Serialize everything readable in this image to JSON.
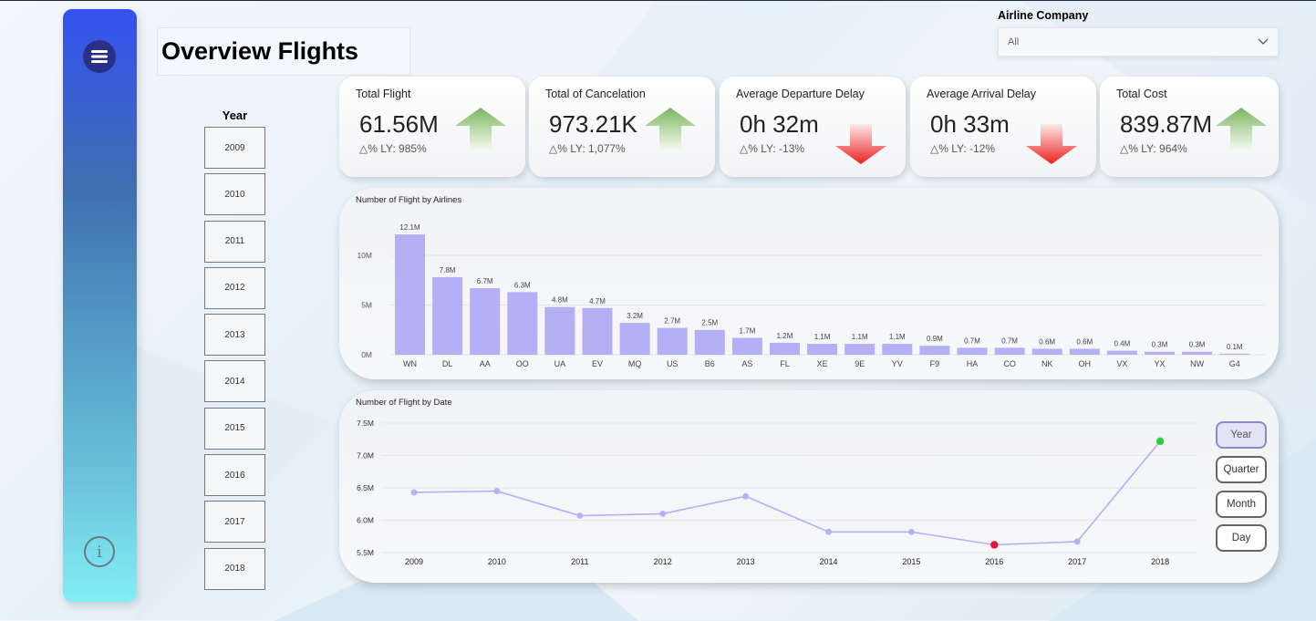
{
  "page": {
    "title": "Overview Flights"
  },
  "year_slicer": {
    "header": "Year",
    "years": [
      "2009",
      "2010",
      "2011",
      "2012",
      "2013",
      "2014",
      "2015",
      "2016",
      "2017",
      "2018"
    ]
  },
  "airline_filter": {
    "label": "Airline Company",
    "value": "All"
  },
  "kpis": [
    {
      "title": "Total Flight",
      "value": "61.56M",
      "ly": "△% LY: 985%",
      "trend": "up"
    },
    {
      "title": "Total of Cancelation",
      "value": "973.21K",
      "ly": "△% LY: 1,077%",
      "trend": "up"
    },
    {
      "title": "Average Departure Delay",
      "value": "0h 32m",
      "ly": "△% LY: -13%",
      "trend": "down"
    },
    {
      "title": "Average Arrival Delay",
      "value": "0h 33m",
      "ly": "△% LY: -12%",
      "trend": "down"
    },
    {
      "title": "Total Cost",
      "value": "839.87M",
      "ly": "△% LY: 964%",
      "trend": "up"
    }
  ],
  "colors": {
    "bar": "#b4b0f6",
    "line": "#b4b0f6",
    "highlight_high": "#2ecc40",
    "highlight_low": "#e0143c",
    "arrow_up": "#7db65f",
    "arrow_down": "#ef1f1f"
  },
  "chart_data": [
    {
      "type": "bar",
      "title": "Number of Flight by Airlines",
      "categories": [
        "WN",
        "DL",
        "AA",
        "OO",
        "UA",
        "EV",
        "MQ",
        "US",
        "B6",
        "AS",
        "FL",
        "XE",
        "9E",
        "YV",
        "F9",
        "HA",
        "CO",
        "NK",
        "OH",
        "VX",
        "YX",
        "NW",
        "G4"
      ],
      "values": [
        12.1,
        7.8,
        6.7,
        6.3,
        4.8,
        4.7,
        3.2,
        2.7,
        2.5,
        1.7,
        1.2,
        1.1,
        1.1,
        1.1,
        0.9,
        0.7,
        0.7,
        0.6,
        0.6,
        0.4,
        0.3,
        0.3,
        0.1
      ],
      "data_labels": [
        "12.1M",
        "7.8M",
        "6.7M",
        "6.3M",
        "4.8M",
        "4.7M",
        "3.2M",
        "2.7M",
        "2.5M",
        "1.7M",
        "1.2M",
        "1.1M",
        "1.1M",
        "1.1M",
        "0.9M",
        "0.7M",
        "0.7M",
        "0.6M",
        "0.6M",
        "0.4M",
        "0.3M",
        "0.3M",
        "0.1M"
      ],
      "unit": "M",
      "yticks": [
        0,
        5,
        10
      ],
      "ytick_labels": [
        "0M",
        "5M",
        "10M"
      ],
      "ylim": [
        0,
        13.3
      ],
      "grid": true
    },
    {
      "type": "line",
      "title": "Number of Flight by Date",
      "x": [
        "2009",
        "2010",
        "2011",
        "2012",
        "2013",
        "2014",
        "2015",
        "2016",
        "2017",
        "2018"
      ],
      "values": [
        6.43,
        6.45,
        6.07,
        6.1,
        6.37,
        5.82,
        5.82,
        5.62,
        5.67,
        7.22
      ],
      "unit": "M",
      "yticks": [
        5.5,
        6.0,
        6.5,
        7.0,
        7.5
      ],
      "ytick_labels": [
        "5.5M",
        "6.0M",
        "6.5M",
        "7.0M",
        "7.5M"
      ],
      "ylim": [
        5.5,
        7.5
      ],
      "highlight_max_index": 9,
      "highlight_min_index": 7,
      "grid": true
    }
  ],
  "granularity": {
    "options": [
      "Year",
      "Quarter",
      "Month",
      "Day"
    ],
    "active": "Year"
  }
}
